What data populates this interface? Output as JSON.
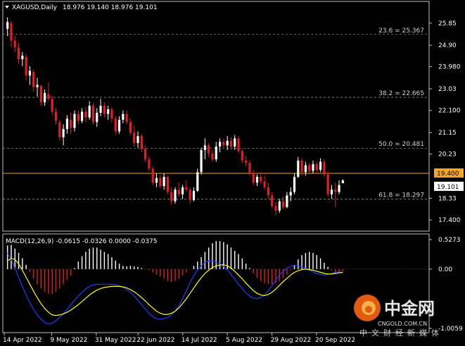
{
  "header": {
    "symbol": "XAGUSD,Daily",
    "ohlc": "18.976 19.140 18.976 19.101"
  },
  "macd_header": "MACD(12,26,9) -0.0615 -0.0326 0.0000 -0.0375",
  "price_labels": [
    "25.85",
    "24.90",
    "23.980",
    "23.03",
    "22.100",
    "21.15",
    "20.23",
    "19.400",
    "19.101",
    "18.33",
    "17.400"
  ],
  "macd_labels": [
    "0.5273",
    "0.00",
    "-1.0059"
  ],
  "date_labels": [
    "14 Apr 2022",
    "9 May 2022",
    "31 May 2022",
    "22 Jun 2022",
    "14 Jul 2022",
    "5 Aug 2022",
    "29 Aug 2022",
    "20 Sep 2022"
  ],
  "fib_levels": [
    {
      "label": "23.6 = 25.367",
      "value": 25.367
    },
    {
      "label": "38.2 = 22.665",
      "value": 22.665
    },
    {
      "label": "50.0 = 20.481",
      "value": 20.481
    },
    {
      "label": "61.8 = 18.297",
      "value": 18.297
    }
  ],
  "horizontal_line": {
    "label": "19.400",
    "value": 19.4,
    "color": "#f5a623"
  },
  "current_price": {
    "label": "19.101",
    "value": 19.101
  },
  "watermark": {
    "brand": "中金网",
    "site": "CNGOLD.COM.CN",
    "slogan": "中文财经新媒体"
  },
  "colors": {
    "bull": "#ffffff",
    "bear": "#e31e24",
    "grid": "#c0c0c0",
    "signal": "#ffff00",
    "macd": "#1e3cff",
    "hist_pos": "#ffffff",
    "hist_neg": "#e31e24"
  },
  "chart_data": {
    "type": "candlestick",
    "symbol": "XAGUSD",
    "timeframe": "Daily",
    "ylim": [
      17.1,
      26.6
    ],
    "macd_ylim": [
      -1.1,
      0.6
    ],
    "candles": [
      {
        "o": 25.6,
        "h": 26.1,
        "l": 25.3,
        "c": 25.9
      },
      {
        "o": 25.85,
        "h": 25.95,
        "l": 24.8,
        "c": 25.1
      },
      {
        "o": 25.1,
        "h": 25.3,
        "l": 24.6,
        "c": 24.8
      },
      {
        "o": 24.8,
        "h": 25.0,
        "l": 24.1,
        "c": 24.3
      },
      {
        "o": 24.3,
        "h": 24.6,
        "l": 24.0,
        "c": 24.45
      },
      {
        "o": 24.4,
        "h": 24.5,
        "l": 23.4,
        "c": 23.6
      },
      {
        "o": 23.6,
        "h": 24.0,
        "l": 23.2,
        "c": 23.8
      },
      {
        "o": 23.75,
        "h": 23.85,
        "l": 22.9,
        "c": 23.1
      },
      {
        "o": 23.1,
        "h": 23.5,
        "l": 22.7,
        "c": 23.2
      },
      {
        "o": 23.15,
        "h": 23.2,
        "l": 22.3,
        "c": 22.45
      },
      {
        "o": 22.45,
        "h": 23.0,
        "l": 22.3,
        "c": 22.85
      },
      {
        "o": 22.8,
        "h": 23.3,
        "l": 22.5,
        "c": 22.6
      },
      {
        "o": 22.6,
        "h": 22.75,
        "l": 21.9,
        "c": 22.05
      },
      {
        "o": 22.05,
        "h": 22.2,
        "l": 21.5,
        "c": 21.65
      },
      {
        "o": 21.6,
        "h": 21.7,
        "l": 20.8,
        "c": 20.95
      },
      {
        "o": 20.95,
        "h": 21.5,
        "l": 20.6,
        "c": 21.3
      },
      {
        "o": 21.3,
        "h": 21.9,
        "l": 21.1,
        "c": 21.75
      },
      {
        "o": 21.7,
        "h": 22.0,
        "l": 21.1,
        "c": 21.35
      },
      {
        "o": 21.35,
        "h": 22.1,
        "l": 21.2,
        "c": 21.95
      },
      {
        "o": 21.95,
        "h": 22.1,
        "l": 21.5,
        "c": 21.65
      },
      {
        "o": 21.65,
        "h": 22.2,
        "l": 21.55,
        "c": 22.05
      },
      {
        "o": 22.05,
        "h": 22.25,
        "l": 21.6,
        "c": 21.8
      },
      {
        "o": 21.8,
        "h": 22.5,
        "l": 21.7,
        "c": 22.3
      },
      {
        "o": 22.3,
        "h": 22.4,
        "l": 21.5,
        "c": 21.6
      },
      {
        "o": 21.6,
        "h": 22.2,
        "l": 21.4,
        "c": 22.0
      },
      {
        "o": 22.0,
        "h": 22.6,
        "l": 21.85,
        "c": 22.3
      },
      {
        "o": 22.3,
        "h": 22.45,
        "l": 21.8,
        "c": 21.95
      },
      {
        "o": 21.95,
        "h": 22.3,
        "l": 21.7,
        "c": 22.15
      },
      {
        "o": 22.15,
        "h": 22.25,
        "l": 21.6,
        "c": 21.75
      },
      {
        "o": 21.75,
        "h": 21.85,
        "l": 21.05,
        "c": 21.2
      },
      {
        "o": 21.2,
        "h": 21.85,
        "l": 21.1,
        "c": 21.7
      },
      {
        "o": 21.7,
        "h": 22.1,
        "l": 21.55,
        "c": 21.95
      },
      {
        "o": 21.95,
        "h": 22.1,
        "l": 21.5,
        "c": 21.6
      },
      {
        "o": 21.6,
        "h": 21.75,
        "l": 21.05,
        "c": 21.15
      },
      {
        "o": 21.15,
        "h": 21.45,
        "l": 20.55,
        "c": 20.7
      },
      {
        "o": 20.7,
        "h": 21.2,
        "l": 20.5,
        "c": 21.0
      },
      {
        "o": 21.0,
        "h": 21.1,
        "l": 20.3,
        "c": 20.45
      },
      {
        "o": 20.45,
        "h": 20.6,
        "l": 19.9,
        "c": 20.0
      },
      {
        "o": 20.0,
        "h": 20.15,
        "l": 19.5,
        "c": 19.6
      },
      {
        "o": 19.6,
        "h": 19.7,
        "l": 18.9,
        "c": 19.0
      },
      {
        "o": 19.0,
        "h": 19.4,
        "l": 18.8,
        "c": 19.2
      },
      {
        "o": 19.2,
        "h": 19.35,
        "l": 18.75,
        "c": 18.85
      },
      {
        "o": 18.85,
        "h": 19.4,
        "l": 18.7,
        "c": 19.25
      },
      {
        "o": 19.25,
        "h": 19.3,
        "l": 18.5,
        "c": 18.6
      },
      {
        "o": 18.6,
        "h": 18.8,
        "l": 18.05,
        "c": 18.2
      },
      {
        "o": 18.2,
        "h": 18.8,
        "l": 18.1,
        "c": 18.7
      },
      {
        "o": 18.7,
        "h": 19.0,
        "l": 18.4,
        "c": 18.5
      },
      {
        "o": 18.5,
        "h": 18.9,
        "l": 18.3,
        "c": 18.8
      },
      {
        "o": 18.8,
        "h": 19.1,
        "l": 18.6,
        "c": 18.7
      },
      {
        "o": 18.7,
        "h": 18.8,
        "l": 18.1,
        "c": 18.25
      },
      {
        "o": 18.25,
        "h": 18.8,
        "l": 18.2,
        "c": 18.65
      },
      {
        "o": 18.65,
        "h": 19.6,
        "l": 18.6,
        "c": 19.45
      },
      {
        "o": 19.45,
        "h": 20.5,
        "l": 19.35,
        "c": 20.4
      },
      {
        "o": 20.4,
        "h": 20.9,
        "l": 20.0,
        "c": 20.6
      },
      {
        "o": 20.6,
        "h": 20.7,
        "l": 20.1,
        "c": 20.25
      },
      {
        "o": 20.25,
        "h": 20.4,
        "l": 19.9,
        "c": 20.0
      },
      {
        "o": 20.0,
        "h": 20.75,
        "l": 19.9,
        "c": 20.55
      },
      {
        "o": 20.55,
        "h": 20.9,
        "l": 20.3,
        "c": 20.75
      },
      {
        "o": 20.75,
        "h": 20.9,
        "l": 20.5,
        "c": 20.6
      },
      {
        "o": 20.6,
        "h": 21.0,
        "l": 20.4,
        "c": 20.8
      },
      {
        "o": 20.8,
        "h": 20.95,
        "l": 20.4,
        "c": 20.55
      },
      {
        "o": 20.55,
        "h": 21.05,
        "l": 20.4,
        "c": 20.9
      },
      {
        "o": 20.9,
        "h": 21.0,
        "l": 20.25,
        "c": 20.35
      },
      {
        "o": 20.35,
        "h": 20.45,
        "l": 19.85,
        "c": 19.95
      },
      {
        "o": 19.95,
        "h": 20.15,
        "l": 19.7,
        "c": 19.85
      },
      {
        "o": 19.85,
        "h": 19.95,
        "l": 19.3,
        "c": 19.4
      },
      {
        "o": 19.4,
        "h": 19.55,
        "l": 18.9,
        "c": 19.0
      },
      {
        "o": 19.0,
        "h": 19.35,
        "l": 18.85,
        "c": 19.25
      },
      {
        "o": 19.25,
        "h": 19.45,
        "l": 18.95,
        "c": 19.05
      },
      {
        "o": 19.05,
        "h": 19.3,
        "l": 18.7,
        "c": 18.8
      },
      {
        "o": 18.8,
        "h": 19.0,
        "l": 18.3,
        "c": 18.45
      },
      {
        "o": 18.45,
        "h": 18.6,
        "l": 17.9,
        "c": 18.0
      },
      {
        "o": 18.0,
        "h": 18.2,
        "l": 17.6,
        "c": 17.8
      },
      {
        "o": 17.8,
        "h": 18.3,
        "l": 17.7,
        "c": 18.2
      },
      {
        "o": 18.2,
        "h": 18.4,
        "l": 17.85,
        "c": 17.95
      },
      {
        "o": 17.95,
        "h": 18.6,
        "l": 17.9,
        "c": 18.45
      },
      {
        "o": 18.45,
        "h": 18.8,
        "l": 18.2,
        "c": 18.6
      },
      {
        "o": 18.6,
        "h": 19.4,
        "l": 18.5,
        "c": 19.25
      },
      {
        "o": 19.25,
        "h": 20.1,
        "l": 19.2,
        "c": 19.95
      },
      {
        "o": 19.95,
        "h": 20.05,
        "l": 19.3,
        "c": 19.45
      },
      {
        "o": 19.45,
        "h": 19.9,
        "l": 19.3,
        "c": 19.75
      },
      {
        "o": 19.75,
        "h": 19.85,
        "l": 19.35,
        "c": 19.5
      },
      {
        "o": 19.5,
        "h": 19.95,
        "l": 19.4,
        "c": 19.8
      },
      {
        "o": 19.8,
        "h": 19.9,
        "l": 19.4,
        "c": 19.55
      },
      {
        "o": 19.55,
        "h": 20.05,
        "l": 19.45,
        "c": 19.9
      },
      {
        "o": 19.9,
        "h": 20.0,
        "l": 19.25,
        "c": 19.35
      },
      {
        "o": 19.35,
        "h": 19.5,
        "l": 18.4,
        "c": 18.5
      },
      {
        "o": 18.5,
        "h": 18.9,
        "l": 18.3,
        "c": 18.7
      },
      {
        "o": 18.7,
        "h": 19.0,
        "l": 17.95,
        "c": 18.6
      },
      {
        "o": 18.6,
        "h": 19.1,
        "l": 18.5,
        "c": 18.9
      },
      {
        "o": 18.976,
        "h": 19.14,
        "l": 18.976,
        "c": 19.101
      }
    ],
    "macd_hist": [
      0.44,
      0.45,
      0.38,
      0.3,
      0.2,
      0.08,
      -0.06,
      -0.18,
      -0.28,
      -0.36,
      -0.42,
      -0.46,
      -0.46,
      -0.42,
      -0.36,
      -0.28,
      -0.2,
      -0.12,
      0.02,
      0.14,
      0.24,
      0.32,
      0.38,
      0.4,
      0.4,
      0.36,
      0.32,
      0.28,
      0.22,
      0.16,
      0.1,
      0.06,
      0.05,
      0.06,
      0.05,
      0.04,
      0.02,
      0.0,
      -0.02,
      -0.06,
      -0.1,
      -0.14,
      -0.18,
      -0.22,
      -0.24,
      -0.22,
      -0.18,
      -0.12,
      -0.06,
      0.0,
      0.06,
      0.14,
      0.22,
      0.32,
      0.4,
      0.48,
      0.52,
      0.52,
      0.5,
      0.46,
      0.4,
      0.34,
      0.28,
      0.2,
      0.1,
      0.02,
      -0.08,
      -0.16,
      -0.22,
      -0.26,
      -0.28,
      -0.28,
      -0.26,
      -0.22,
      -0.16,
      -0.1,
      -0.02,
      0.08,
      0.18,
      0.26,
      0.3,
      0.32,
      0.3,
      0.26,
      0.2,
      0.12,
      0.04,
      -0.02,
      -0.06,
      -0.06,
      -0.04
    ],
    "macd_line": [
      0.3,
      0.18,
      0.02,
      -0.15,
      -0.32,
      -0.48,
      -0.62,
      -0.75,
      -0.85,
      -0.93,
      -0.99,
      -1.02,
      -1.0,
      -0.96,
      -0.9,
      -0.83,
      -0.75,
      -0.66,
      -0.58,
      -0.5,
      -0.43,
      -0.37,
      -0.32,
      -0.29,
      -0.28,
      -0.28,
      -0.28,
      -0.28,
      -0.28,
      -0.29,
      -0.31,
      -0.34,
      -0.38,
      -0.43,
      -0.5,
      -0.58,
      -0.66,
      -0.74,
      -0.82,
      -0.88,
      -0.92,
      -0.93,
      -0.92,
      -0.9,
      -0.85,
      -0.78,
      -0.68,
      -0.55,
      -0.4,
      -0.25,
      -0.12,
      -0.02,
      0.06,
      0.12,
      0.15,
      0.15,
      0.13,
      0.1,
      0.05,
      -0.02,
      -0.1,
      -0.19,
      -0.28,
      -0.36,
      -0.44,
      -0.5,
      -0.54,
      -0.55,
      -0.53,
      -0.48,
      -0.4,
      -0.3,
      -0.2,
      -0.11,
      -0.04,
      0.02,
      0.05,
      0.07,
      0.06,
      0.04,
      0.01,
      -0.02,
      -0.05,
      -0.08,
      -0.1,
      -0.11,
      -0.1,
      -0.08,
      -0.06,
      -0.05,
      -0.06
    ],
    "signal_line": [
      0.15,
      0.2,
      0.18,
      0.1,
      -0.02,
      -0.15,
      -0.28,
      -0.41,
      -0.53,
      -0.64,
      -0.73,
      -0.8,
      -0.85,
      -0.86,
      -0.85,
      -0.83,
      -0.8,
      -0.76,
      -0.71,
      -0.66,
      -0.6,
      -0.54,
      -0.48,
      -0.43,
      -0.39,
      -0.36,
      -0.34,
      -0.33,
      -0.32,
      -0.32,
      -0.32,
      -0.33,
      -0.35,
      -0.38,
      -0.42,
      -0.47,
      -0.53,
      -0.59,
      -0.66,
      -0.72,
      -0.78,
      -0.82,
      -0.84,
      -0.84,
      -0.82,
      -0.78,
      -0.72,
      -0.64,
      -0.55,
      -0.45,
      -0.35,
      -0.25,
      -0.16,
      -0.08,
      -0.02,
      0.03,
      0.06,
      0.08,
      0.08,
      0.06,
      0.02,
      -0.04,
      -0.11,
      -0.18,
      -0.26,
      -0.33,
      -0.4,
      -0.45,
      -0.48,
      -0.49,
      -0.47,
      -0.43,
      -0.37,
      -0.3,
      -0.23,
      -0.17,
      -0.11,
      -0.06,
      -0.03,
      -0.01,
      0.0,
      -0.01,
      -0.02,
      -0.04,
      -0.06,
      -0.08,
      -0.09,
      -0.09,
      -0.08,
      -0.07,
      -0.06
    ]
  }
}
